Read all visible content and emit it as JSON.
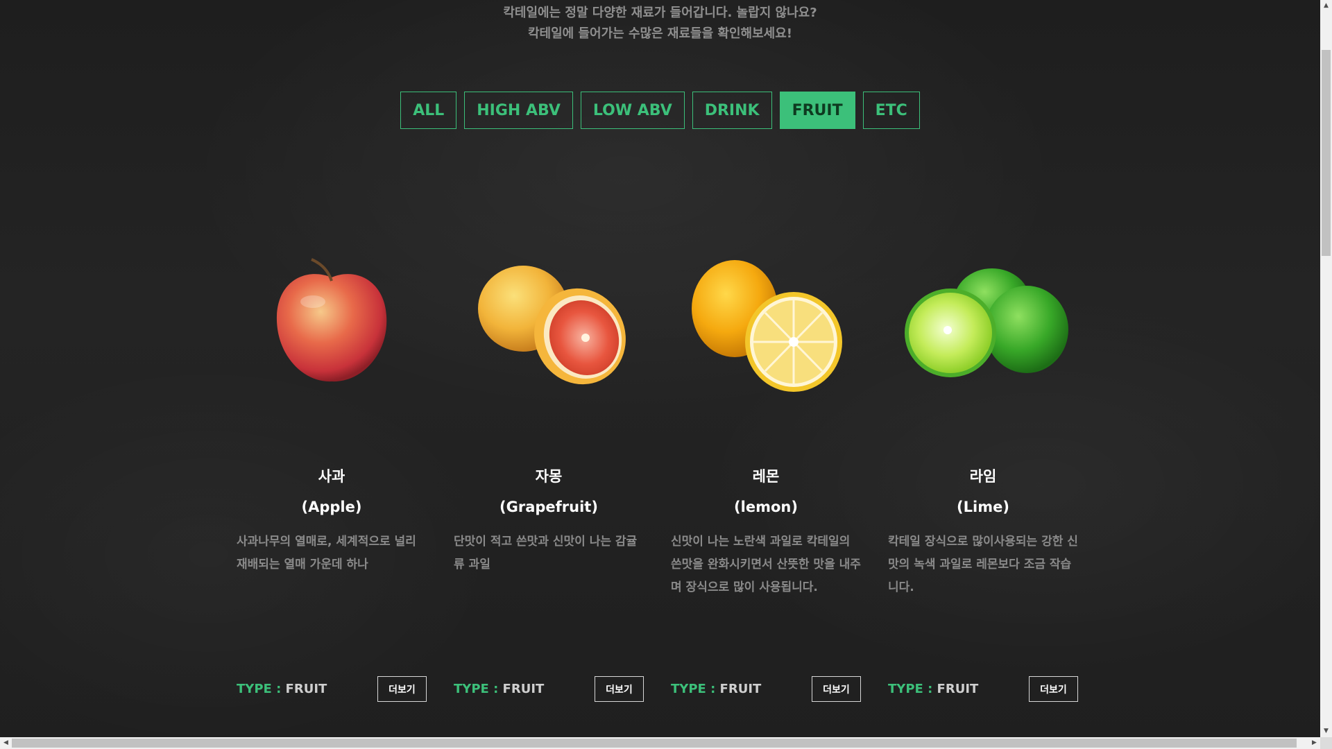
{
  "intro": {
    "line1": "칵테일에는 정말 다양한 재료가 들어갑니다. 놀랍지 않나요?",
    "line2": "칵테일에 들어가는 수많은 재료들을 확인해보세요!"
  },
  "filters": [
    {
      "label": "ALL",
      "active": false
    },
    {
      "label": "HIGH ABV",
      "active": false
    },
    {
      "label": "LOW ABV",
      "active": false
    },
    {
      "label": "DRINK",
      "active": false
    },
    {
      "label": "FRUIT",
      "active": true
    },
    {
      "label": "ETC",
      "active": false
    }
  ],
  "cards": [
    {
      "icon": "apple-image",
      "name_ko": "사과",
      "name_en": "(Apple)",
      "description": "사과나무의 열매로, 세계적으로 널리 재배되는 열매 가운데 하나",
      "type_label": "TYPE : ",
      "type_value": "FRUIT",
      "more_label": "더보기"
    },
    {
      "icon": "grapefruit-image",
      "name_ko": "자몽",
      "name_en": "(Grapefruit)",
      "description": "단맛이 적고 쓴맛과 신맛이 나는 감귤류 과일",
      "type_label": "TYPE : ",
      "type_value": "FRUIT",
      "more_label": "더보기"
    },
    {
      "icon": "lemon-image",
      "name_ko": "레몬",
      "name_en": "(lemon)",
      "description": "신맛이 나는 노란색 과일로 칵테일의 쓴맛을 완화시키면서 산뜻한 맛을 내주며 장식으로 많이 사용됩니다.",
      "type_label": "TYPE : ",
      "type_value": "FRUIT",
      "more_label": "더보기"
    },
    {
      "icon": "lime-image",
      "name_ko": "라임",
      "name_en": "(Lime)",
      "description": "칵테일 장식으로 많이사용되는 강한 신맛의 녹색 과일로 레몬보다 조금 작습니다.",
      "type_label": "TYPE : ",
      "type_value": "FRUIT",
      "more_label": "더보기"
    }
  ],
  "colors": {
    "accent": "#3cc07a",
    "background": "#222222",
    "text_muted": "#8a8a8a"
  }
}
